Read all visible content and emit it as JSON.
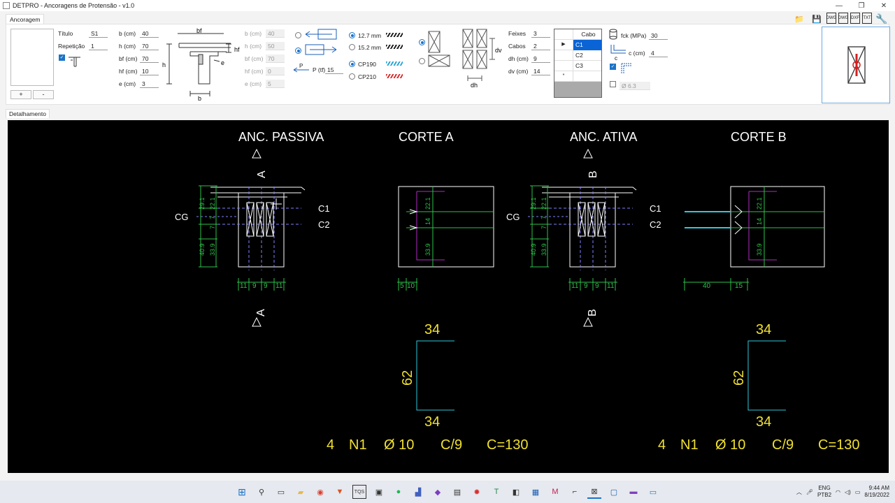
{
  "window": {
    "title": "DETPRO - Ancoragens de Protensão - v1.0",
    "controls": [
      "minimize-icon",
      "maximize-icon",
      "close-icon"
    ]
  },
  "tabs": {
    "ancoragem": "Ancoragem",
    "detalhamento": "Detalhamento"
  },
  "toolbar": {
    "icons": [
      "folder-icon",
      "save-icon",
      "dwg-export-icon",
      "dwg-export-icon",
      "dxf-export-icon",
      "txt-export-icon",
      "wrench-icon"
    ],
    "dwg1": "DWG",
    "dwg2": "DWG",
    "dxf": "DXF",
    "txt": "TXT"
  },
  "left": {
    "titulo_label": "Título",
    "titulo_value": "S1",
    "repeticao_label": "Repetição",
    "repeticao_value": "1",
    "add_label": "+",
    "remove_label": "-"
  },
  "section": {
    "b_label": "b (cm)",
    "b": "40",
    "h_label": "h (cm)",
    "h": "70",
    "bf_label": "bf (cm)",
    "bf": "70",
    "hf_label": "hf (cm)",
    "hf": "10",
    "e_label": "e (cm)",
    "e": "3"
  },
  "section_diagram": {
    "bf": "bf",
    "h": "h",
    "hf": "hf",
    "e": "e",
    "b": "b"
  },
  "section2": {
    "b_label": "b (cm)",
    "b": "40",
    "h_label": "h (cm)",
    "h": "50",
    "bf_label": "bf (cm)",
    "bf": "70",
    "hf_label": "hf (cm)",
    "hf": "0",
    "e_label": "e (cm)",
    "e": "5"
  },
  "force": {
    "p_label": "P",
    "pf_label": "P (tf)",
    "pf_value": "15"
  },
  "cable": {
    "d127": "12.7 mm",
    "d152": "15.2 mm",
    "cp190": "CP190",
    "cp210": "CP210"
  },
  "bundle": {
    "feixes_label": "Feixes",
    "feixes": "3",
    "cabos_label": "Cabos",
    "cabos": "2",
    "dh_label": "dh (cm)",
    "dh": "9",
    "dv_label": "dv (cm)",
    "dv": "14",
    "dv_tag": "dv",
    "dh_tag": "dh"
  },
  "cable_grid": {
    "header": "Cabo",
    "rows": [
      "C1",
      "C2",
      "C3"
    ]
  },
  "concrete": {
    "fck_label": "fck (MPa)",
    "fck": "30",
    "c_label": "c (cm)",
    "c": "4",
    "c_tag": "c",
    "phi_value": "Ø 6.3"
  },
  "drawing": {
    "anc_passiva": "ANC. PASSIVA",
    "corte_a": "CORTE A",
    "anc_ativa": "ANC. ATIVA",
    "corte_b": "CORTE B",
    "sec_a": "A",
    "sec_b": "B",
    "cg": "CG",
    "c1": "C1",
    "c2": "C2",
    "dims_vert": [
      "29.1",
      "22.1",
      "7",
      "7",
      "40.9",
      "33.9"
    ],
    "dims_horiz": [
      "11",
      "9",
      "9",
      "11"
    ],
    "corte_a_dims": [
      "22.1",
      "14",
      "33.9"
    ],
    "corte_a_bottom": [
      "5",
      "10"
    ],
    "corte_b_bottom": [
      "40",
      "15"
    ],
    "stirrup_top": "34",
    "stirrup_side": "62",
    "stirrup_bottom": "34",
    "callout": {
      "qty": "4",
      "mark": "N1",
      "dia": "Ø 10",
      "spacing": "C/9",
      "length": "C=130"
    }
  },
  "taskbar": {
    "apps": [
      "windows-start-icon",
      "search-icon",
      "task-view-icon",
      "file-explorer-icon",
      "chrome-icon",
      "brave-icon",
      "tqs-icon",
      "terminal-icon",
      "spotify-icon",
      "app-icon",
      "visual-studio-icon",
      "app-icon",
      "app-icon",
      "app-icon",
      "app-icon",
      "app-icon",
      "app-icon",
      "app-icon",
      "detpro-icon",
      "app-icon",
      "app-icon",
      "app-icon"
    ],
    "tqs": "TQS",
    "lang": "ENG",
    "layout": "PTB2",
    "time": "9:44 AM",
    "date": "8/19/2022"
  },
  "colors": {
    "canvas": "#000000",
    "title_text": "#ffffff",
    "yellow": "#f0e030",
    "green": "#2ec24a",
    "cyan": "#30c8d8",
    "magenta": "#b02cc0",
    "blue_sel": "#0a64d6"
  }
}
